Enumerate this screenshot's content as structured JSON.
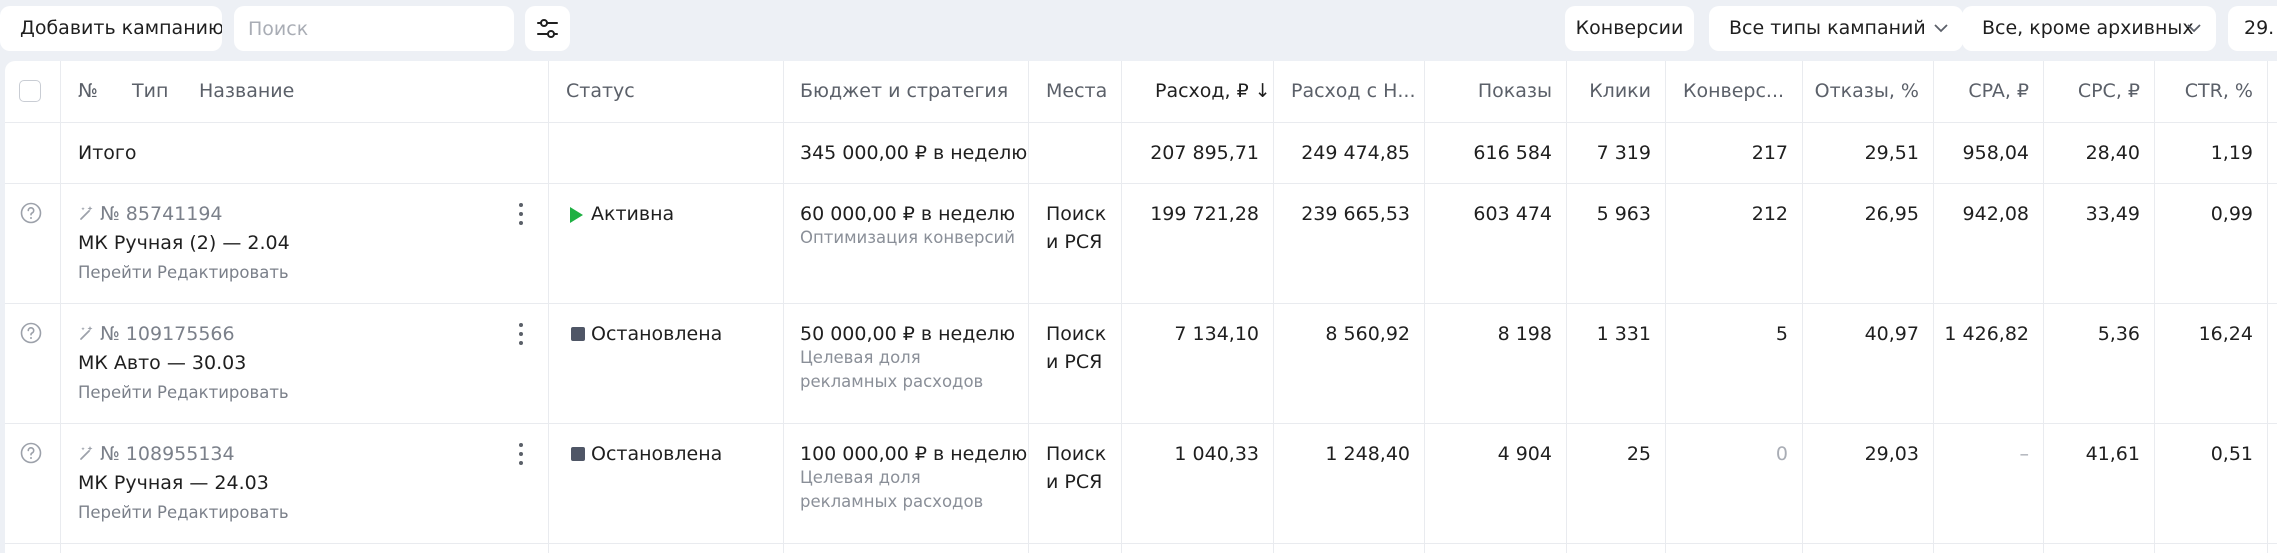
{
  "toolbar": {
    "add_campaign": "Добавить кампанию",
    "search_placeholder": "Поиск",
    "conversions": "Конверсии",
    "campaign_types": "Все типы кампаний",
    "archive_filter": "Все, кроме архивных",
    "date_truncated": "29."
  },
  "table": {
    "headers": {
      "number": "№",
      "type": "Тип",
      "name": "Название",
      "status": "Статус",
      "budget": "Бюджет и стратегия",
      "places": "Места",
      "spend": "Расход, ₽ ↓",
      "spend_vat": "Расход с Н...",
      "impressions": "Показы",
      "clicks": "Клики",
      "conversions": "Конверс...",
      "bounces": "Отказы, %",
      "cpa": "CPA, ₽",
      "cpc": "CPC, ₽",
      "ctr": "CTR, %"
    },
    "total": {
      "label": "Итого",
      "budget": "345 000,00 ₽ в неделю",
      "spend": "207 895,71",
      "spend_vat": "249 474,85",
      "impressions": "616 584",
      "clicks": "7 319",
      "conversions": "217",
      "bounces": "29,51",
      "cpa": "958,04",
      "cpc": "28,40",
      "ctr": "1,19"
    },
    "rows": [
      {
        "id": "№ 85741194",
        "name": "МК Ручная (2) — 2.04",
        "link_go": "Перейти",
        "link_edit": "Редактировать",
        "status": "Активна",
        "budget": "60 000,00 ₽ в неделю",
        "strategy": "Оптимизация конверсий",
        "places_1": "Поиск",
        "places_2": "и РСЯ",
        "spend": "199 721,28",
        "spend_vat": "239 665,53",
        "impressions": "603 474",
        "clicks": "5 963",
        "conversions": "212",
        "bounces": "26,95",
        "cpa": "942,08",
        "cpc": "33,49",
        "ctr": "0,99"
      },
      {
        "id": "№ 109175566",
        "name": "МК Авто — 30.03",
        "link_go": "Перейти",
        "link_edit": "Редактировать",
        "status": "Остановлена",
        "budget": "50 000,00 ₽ в неделю",
        "strategy": "Целевая доля рекламных расходов",
        "places_1": "Поиск",
        "places_2": "и РСЯ",
        "spend": "7 134,10",
        "spend_vat": "8 560,92",
        "impressions": "8 198",
        "clicks": "1 331",
        "conversions": "5",
        "bounces": "40,97",
        "cpa": "1 426,82",
        "cpc": "5,36",
        "ctr": "16,24"
      },
      {
        "id": "№ 108955134",
        "name": "МК Ручная — 24.03",
        "link_go": "Перейти",
        "link_edit": "Редактировать",
        "status": "Остановлена",
        "budget": "100 000,00 ₽ в неделю",
        "strategy": "Целевая доля рекламных расходов",
        "places_1": "Поиск",
        "places_2": "и РСЯ",
        "spend": "1 040,33",
        "spend_vat": "1 248,40",
        "impressions": "4 904",
        "clicks": "25",
        "conversions": "0",
        "bounces": "29,03",
        "cpa": "–",
        "cpc": "41,61",
        "ctr": "0,51"
      }
    ]
  },
  "colors": {
    "active_status": "#1eb043",
    "stopped_status": "#4f5666",
    "background": "#edf0f5"
  }
}
